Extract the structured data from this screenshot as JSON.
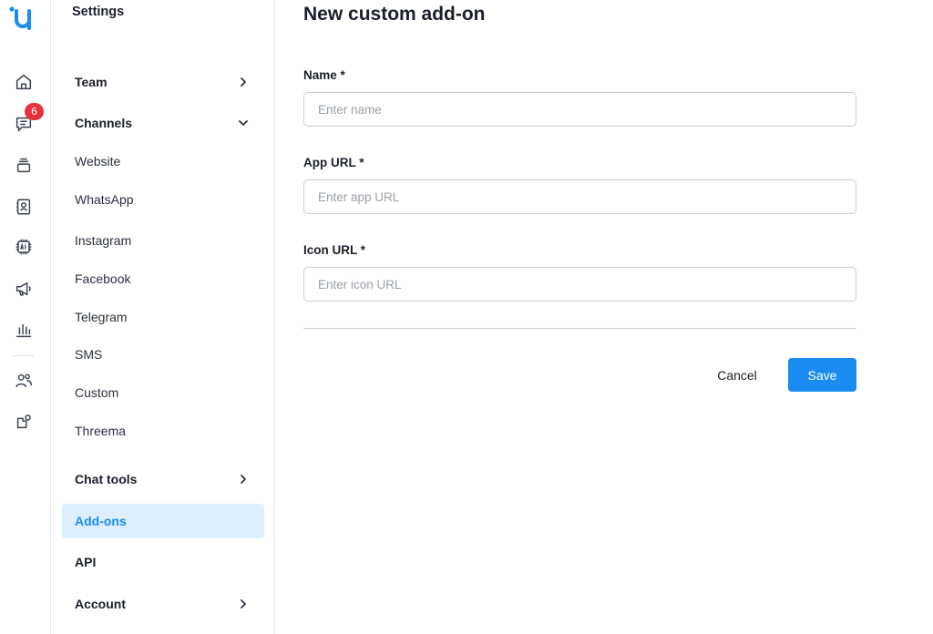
{
  "colors": {
    "accent": "#1a8cf2",
    "badge": "#e5323d",
    "active_bg": "#ddeefd"
  },
  "rail": {
    "logo": "brand-u-icon",
    "items": [
      {
        "icon": "home-icon"
      },
      {
        "icon": "chat-bubble-icon",
        "badge": "6"
      },
      {
        "icon": "stack-icon"
      },
      {
        "icon": "contacts-book-icon"
      },
      {
        "icon": "ai-chip-icon"
      },
      {
        "icon": "megaphone-icon"
      },
      {
        "icon": "bar-chart-icon"
      },
      {
        "icon": "team-icon"
      },
      {
        "icon": "integrations-icon"
      }
    ]
  },
  "nav": {
    "title": "Settings",
    "items": [
      {
        "label": "Team",
        "chevron": "right"
      },
      {
        "label": "Channels",
        "chevron": "down"
      },
      {
        "label": "Website"
      },
      {
        "label": "WhatsApp"
      },
      {
        "label": "Instagram"
      },
      {
        "label": "Facebook"
      },
      {
        "label": "Telegram"
      },
      {
        "label": "SMS"
      },
      {
        "label": "Custom"
      },
      {
        "label": "Threema"
      },
      {
        "label": "Chat tools",
        "chevron": "right"
      },
      {
        "label": "Add-ons",
        "active": true
      },
      {
        "label": "API"
      },
      {
        "label": "Account",
        "chevron": "right"
      }
    ]
  },
  "form": {
    "title": "New custom add-on",
    "fields": [
      {
        "label": "Name *",
        "placeholder": "Enter name",
        "value": ""
      },
      {
        "label": "App URL *",
        "placeholder": "Enter app URL",
        "value": ""
      },
      {
        "label": "Icon URL *",
        "placeholder": "Enter icon URL",
        "value": ""
      }
    ],
    "cancel_label": "Cancel",
    "save_label": "Save"
  }
}
